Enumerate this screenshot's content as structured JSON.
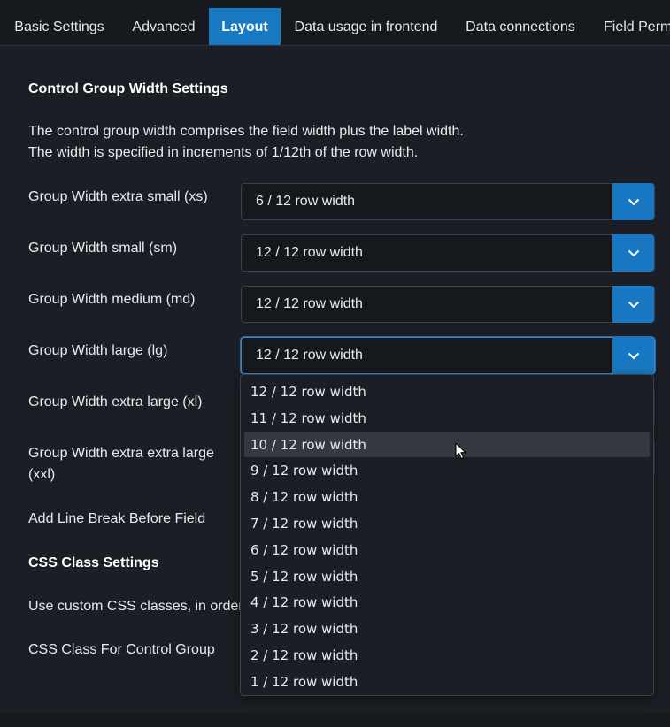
{
  "tabs": [
    {
      "label": "Basic Settings",
      "active": false
    },
    {
      "label": "Advanced",
      "active": false
    },
    {
      "label": "Layout",
      "active": true
    },
    {
      "label": "Data usage in frontend",
      "active": false
    },
    {
      "label": "Data connections",
      "active": false
    },
    {
      "label": "Field Perm",
      "active": false
    }
  ],
  "section1": {
    "title": "Control Group Width Settings",
    "desc_line1": "The control group width comprises the field width plus the label width.",
    "desc_line2": "The width is specified in increments of 1/12th of the row width."
  },
  "fields": {
    "xs": {
      "label": "Group Width extra small (xs)",
      "value": "6 / 12 row width"
    },
    "sm": {
      "label": "Group Width small (sm)",
      "value": "12 / 12 row width"
    },
    "md": {
      "label": "Group Width medium (md)",
      "value": "12 / 12 row width"
    },
    "lg": {
      "label": "Group Width large (lg)",
      "value": "12 / 12 row width"
    },
    "xl": {
      "label": "Group Width extra large (xl)"
    },
    "xxl": {
      "label_line1": "Group Width extra extra large",
      "label_line2": "(xxl)"
    },
    "line_break": {
      "label": "Add Line Break Before Field"
    }
  },
  "section2": {
    "title": "CSS Class Settings",
    "desc": "Use custom CSS classes, in order",
    "css_class_label": "CSS Class For Control Group"
  },
  "dropdown": {
    "options": [
      "12 / 12 row width",
      "11 / 12 row width",
      "10 / 12 row width",
      "9 / 12 row width",
      "8 / 12 row width",
      "7 / 12 row width",
      "6 / 12 row width",
      "5 / 12 row width",
      "4 / 12 row width",
      "3 / 12 row width",
      "2 / 12 row width",
      "1 / 12 row width"
    ],
    "hovered_index": 2
  },
  "colors": {
    "accent": "#1779c1",
    "background": "#1b1e24"
  }
}
